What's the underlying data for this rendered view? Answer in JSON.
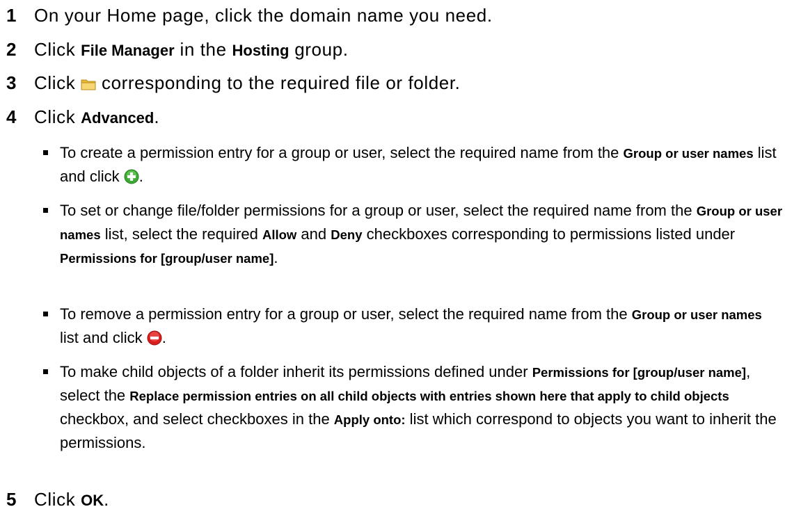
{
  "steps": [
    {
      "num": "1",
      "text": "On your Home page, click the domain name you need."
    },
    {
      "num": "2",
      "t1": "Click ",
      "b1": "File Manager",
      "t2": " in the ",
      "b2": "Hosting",
      "t3": " group."
    },
    {
      "num": "3",
      "t1": "Click ",
      "t2": " corresponding to the required file or folder."
    },
    {
      "num": "4",
      "t1": "Click ",
      "b1": "Advanced",
      "t2": "."
    },
    {
      "num": "5",
      "t1": "Click ",
      "b1": "OK",
      "t2": "."
    }
  ],
  "bullets": [
    {
      "t1": "To create a permission entry for a group or user, select the required name from the ",
      "b1": "Group or user names",
      "t2": " list and click ",
      "t3": "."
    },
    {
      "t1": "To set or change file/folder permissions for a group or user, select the required name from the ",
      "b1": "Group or user names",
      "t2": " list, select the required ",
      "b2": "Allow",
      "t3": " and ",
      "b3": "Deny",
      "t4": " checkboxes corresponding to permissions listed under ",
      "b4": "Permissions for [group/user name]",
      "t5": "."
    },
    {
      "t1": "To remove a permission entry for a group or user, select the required name from the ",
      "b1": "Group or user names",
      "t2": " list and click ",
      "t3": "."
    },
    {
      "t1": "To make child objects of a folder inherit its permissions defined under ",
      "b1": "Permissions for [group/user name]",
      "t2": ", select the ",
      "b2": "Replace permission entries on all child objects with entries shown here that apply to child objects",
      "t3": " checkbox, and select checkboxes in the ",
      "b3": "Apply onto:",
      "t4": " list which correspond to objects you want to inherit the permissions."
    }
  ],
  "icons": {
    "folder": "folder-icon",
    "add": "add-icon",
    "remove": "remove-icon"
  },
  "colors": {
    "folder": "#f2c94c",
    "add": "#3cab34",
    "remove": "#d81e1e"
  }
}
